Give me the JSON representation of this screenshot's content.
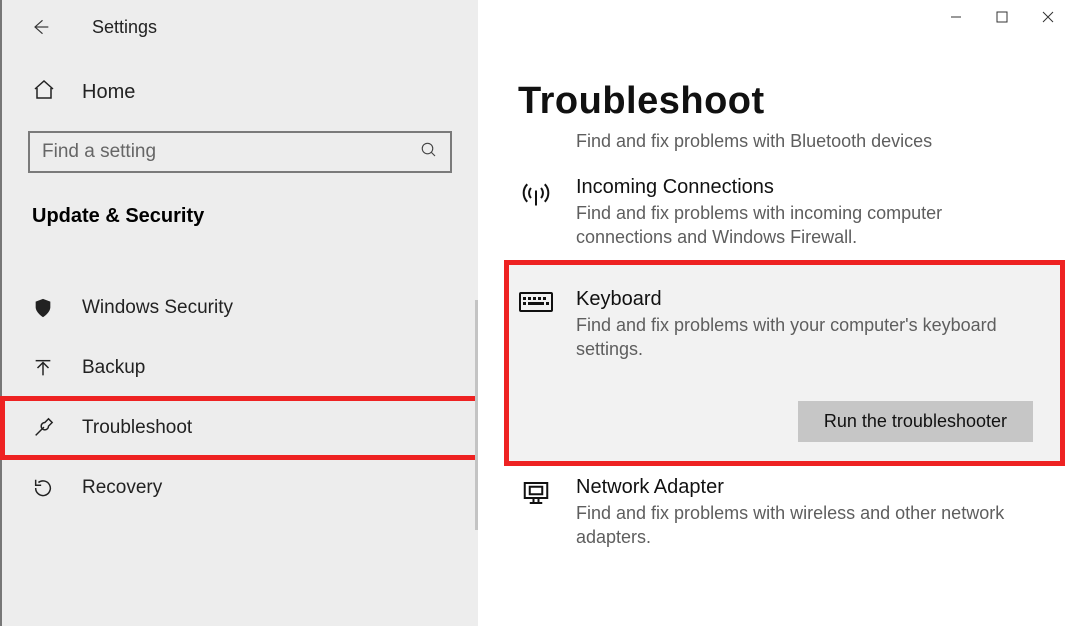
{
  "titlebar": {
    "title": "Settings"
  },
  "sidebar": {
    "home_label": "Home",
    "search_placeholder": "Find a setting",
    "section_header": "Update & Security",
    "items": [
      {
        "label": "Windows Security"
      },
      {
        "label": "Backup"
      },
      {
        "label": "Troubleshoot"
      },
      {
        "label": "Recovery"
      }
    ]
  },
  "main": {
    "page_title": "Troubleshoot",
    "partial_subtitle": "Find and fix problems with Bluetooth devices",
    "items": [
      {
        "title": "Incoming Connections",
        "subtitle": "Find and fix problems with incoming computer connections and Windows Firewall."
      },
      {
        "title": "Keyboard",
        "subtitle": "Find and fix problems with your computer's keyboard settings.",
        "action": "Run the troubleshooter"
      },
      {
        "title": "Network Adapter",
        "subtitle": "Find and fix problems with wireless and other network adapters."
      }
    ]
  }
}
